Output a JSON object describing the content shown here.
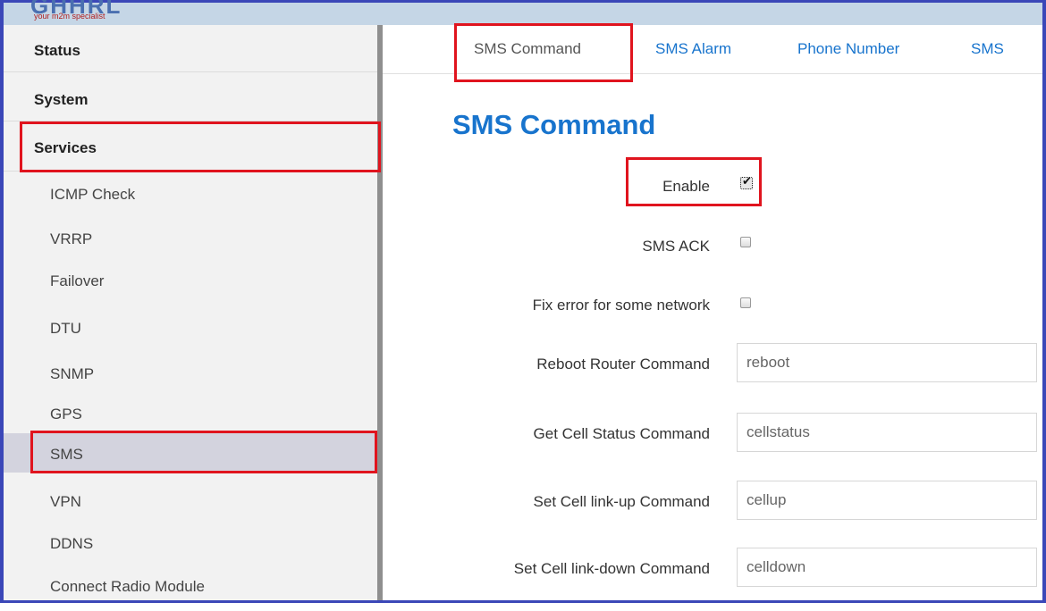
{
  "header": {
    "logo_text": "GHHRL",
    "tagline": "your m2m specialist"
  },
  "sidebar": {
    "top_items": [
      "Status",
      "System",
      "Services"
    ],
    "sub_items": [
      "ICMP Check",
      "VRRP",
      "Failover",
      "DTU",
      "SNMP",
      "GPS",
      "SMS",
      "VPN",
      "DDNS",
      "Connect Radio Module"
    ],
    "selected_top": "Services",
    "selected_sub": "SMS"
  },
  "tabs": [
    "SMS Command",
    "SMS Alarm",
    "Phone Number",
    "SMS"
  ],
  "active_tab": "SMS Command",
  "page_title": "SMS Command",
  "form": {
    "enable_label": "Enable",
    "enable_checked": true,
    "sms_ack_label": "SMS ACK",
    "sms_ack_checked": false,
    "fix_error_label": "Fix error for some network",
    "fix_error_checked": false,
    "reboot_label": "Reboot Router Command",
    "reboot_value": "reboot",
    "cell_status_label": "Get Cell Status Command",
    "cell_status_value": "cellstatus",
    "cell_up_label": "Set Cell link-up Command",
    "cell_up_value": "cellup",
    "cell_down_label": "Set Cell link-down Command",
    "cell_down_value": "celldown"
  },
  "colors": {
    "accent": "#1874cd",
    "highlight_box": "#e0141e",
    "frame": "#3b47b8"
  }
}
